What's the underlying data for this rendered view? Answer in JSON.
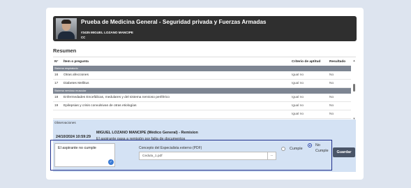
{
  "header": {
    "title": "Prueba de Medicina General - Seguridad privada y Fuerzas Armadas",
    "id_line": "#3435  MIGUEL LOZANO MANCIPE",
    "doc_type": "CC"
  },
  "section_title": "Resumen",
  "table": {
    "headers": {
      "num": "N°",
      "item": "Ítem o pregunta",
      "criteria": "Criterio de aptitud",
      "result": "Resultado"
    },
    "group1": "Sistema respiratorio",
    "group2": "Sistema nervioso muscular",
    "rows": [
      {
        "num": "16",
        "item": "Otras afecciones",
        "criteria": "Igual no",
        "result": "No"
      },
      {
        "num": "17",
        "item": "Diabetes Mellitus",
        "criteria": "Igual no",
        "result": "No"
      },
      {
        "num": "18",
        "item": "Enfermedades Encefálicas, medulares y del sistema nervioso periférico",
        "criteria": "Igual no",
        "result": "No"
      },
      {
        "num": "19",
        "item": "Epilepsias y crisis convulsivas de otras etiologías",
        "criteria": "Igual no",
        "result": "No"
      },
      {
        "num": "",
        "item": "",
        "criteria": "Igual no",
        "result": "No"
      }
    ]
  },
  "observations": {
    "label": "Observaciones",
    "date": "24/10/2024 10:59:29",
    "author": "MIGUEL LOZANO MANCIPE (Médico General) - Remision",
    "text": "El aspirante pasa a remisión por falta de documentos"
  },
  "form": {
    "textarea_value": "El aspirante no cumple",
    "concept_label": "Concepto del Especialista externo (PDF)",
    "file_value": "Cedula_1.pdf",
    "file_button": "...",
    "radio_cumple": "Cumple",
    "radio_no_cumple_1": "No",
    "radio_no_cumple_2": "Cumple",
    "save_button": "Guardar"
  }
}
